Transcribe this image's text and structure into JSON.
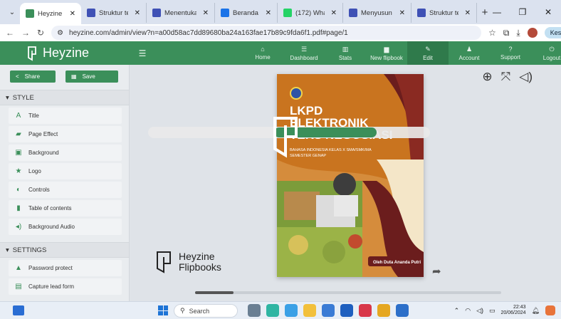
{
  "browser": {
    "tabs": [
      {
        "title": "Heyzine ·",
        "favicon_color": "#3b8f5a",
        "active": true
      },
      {
        "title": "Struktur teks",
        "favicon_color": "#3f51b5",
        "active": false
      },
      {
        "title": "Menentukan",
        "favicon_color": "#3f51b5",
        "active": false
      },
      {
        "title": "Beranda - Ca",
        "favicon_color": "#1a73e8",
        "active": false
      },
      {
        "title": "(172) WhatsA",
        "favicon_color": "#25d366",
        "active": false
      },
      {
        "title": "Menyusun Te",
        "favicon_color": "#3f51b5",
        "active": false
      },
      {
        "title": "Struktur teks",
        "favicon_color": "#3f51b5",
        "active": false
      }
    ],
    "new_tab": "+",
    "url": "heyzine.com/admin/view?n=a00d58ac7dd89680ba24a163fae17b89c9fda6f1.pdf#page/1",
    "error_label": "Kesalahan"
  },
  "header": {
    "brand": "Heyzine",
    "nav": [
      {
        "label": "Home",
        "icon": "home-icon",
        "glyph": "⌂",
        "active": false
      },
      {
        "label": "Dashboard",
        "icon": "dashboard-icon",
        "glyph": "☰",
        "active": false
      },
      {
        "label": "Stats",
        "icon": "stats-icon",
        "glyph": "▥",
        "active": false
      },
      {
        "label": "New flipbook",
        "icon": "new-file-icon",
        "glyph": "▆",
        "active": false
      },
      {
        "label": "Edit",
        "icon": "pencil-icon",
        "glyph": "✎",
        "active": true
      },
      {
        "label": "Account",
        "icon": "user-icon",
        "glyph": "♟",
        "active": false
      },
      {
        "label": "Support",
        "icon": "question-icon",
        "glyph": "?",
        "active": false
      },
      {
        "label": "Logout",
        "icon": "power-icon",
        "glyph": "⏻",
        "active": false
      }
    ]
  },
  "sidebar": {
    "share_label": "Share",
    "save_label": "Save",
    "style_heading": "STYLE",
    "style_items": [
      {
        "label": "Title",
        "icon": "title-icon",
        "glyph": "A"
      },
      {
        "label": "Page Effect",
        "icon": "book-icon",
        "glyph": "▰"
      },
      {
        "label": "Background",
        "icon": "image-icon",
        "glyph": "▣"
      },
      {
        "label": "Logo",
        "icon": "star-icon",
        "glyph": "★"
      },
      {
        "label": "Controls",
        "icon": "toggle-icon",
        "glyph": "◐"
      },
      {
        "label": "Table of contents",
        "icon": "bookmark-icon",
        "glyph": "▮"
      },
      {
        "label": "Background Audio",
        "icon": "audio-icon",
        "glyph": "◂)"
      }
    ],
    "settings_heading": "SETTINGS",
    "settings_items": [
      {
        "label": "Password protect",
        "icon": "lock-icon",
        "glyph": "▲"
      },
      {
        "label": "Capture lead form",
        "icon": "form-icon",
        "glyph": "▤"
      }
    ]
  },
  "cover": {
    "title_line1": "LKPD",
    "title_line2": "ELEKTRONIK",
    "title_line3": "TEKS NEGOSIASI",
    "subtitle_line1": "BAHASA INDONESIA KELAS X SMA/SMK/MA",
    "subtitle_line2": "SEMESTER GENAP",
    "author": "Oleh Duta Ananda Putri"
  },
  "watermark": {
    "line1": "Heyzine",
    "line2": "Flipbooks",
    "vertical": "Powered by"
  },
  "taskbar": {
    "search": "Search",
    "time": "22:43",
    "date": "20/06/2024"
  },
  "colors": {
    "brand_green": "#3b8f5a",
    "cover_orange": "#c9741f",
    "cover_maroon": "#6b1d1d"
  }
}
